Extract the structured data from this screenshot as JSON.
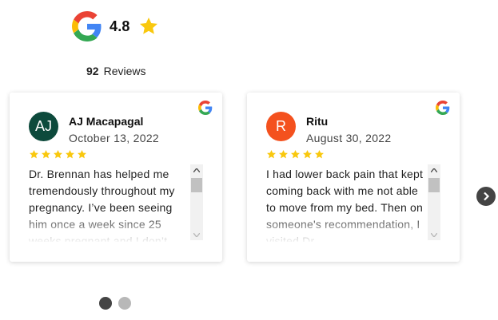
{
  "summary": {
    "rating": "4.8",
    "review_count": "92",
    "reviews_label": "Reviews",
    "logo_icon": "google-logo-icon",
    "star_icon": "star-icon"
  },
  "reviews": [
    {
      "initials": "AJ",
      "avatar_color": "#0d4a3c",
      "name": "AJ Macapagal",
      "date": "October 13, 2022",
      "stars": 5,
      "text": "Dr. Brennan has helped me tremendously throughout my pregnancy. I’ve been seeing him once a week since 25 weeks pregnant and I don’t"
    },
    {
      "initials": "R",
      "avatar_color": "#f4511e",
      "name": "Ritu",
      "date": "August 30, 2022",
      "stars": 5,
      "text": "I had lower back pain that kept coming back with me not able to move from my bed. Then on someone's recommendation, I visited Dr"
    }
  ],
  "carousel": {
    "next_icon": "chevron-right-icon",
    "pages": 2,
    "active_page": 1
  },
  "colors": {
    "star": "#f9c80e",
    "dot_active": "#444444",
    "dot_inactive": "#b8b8b8"
  }
}
